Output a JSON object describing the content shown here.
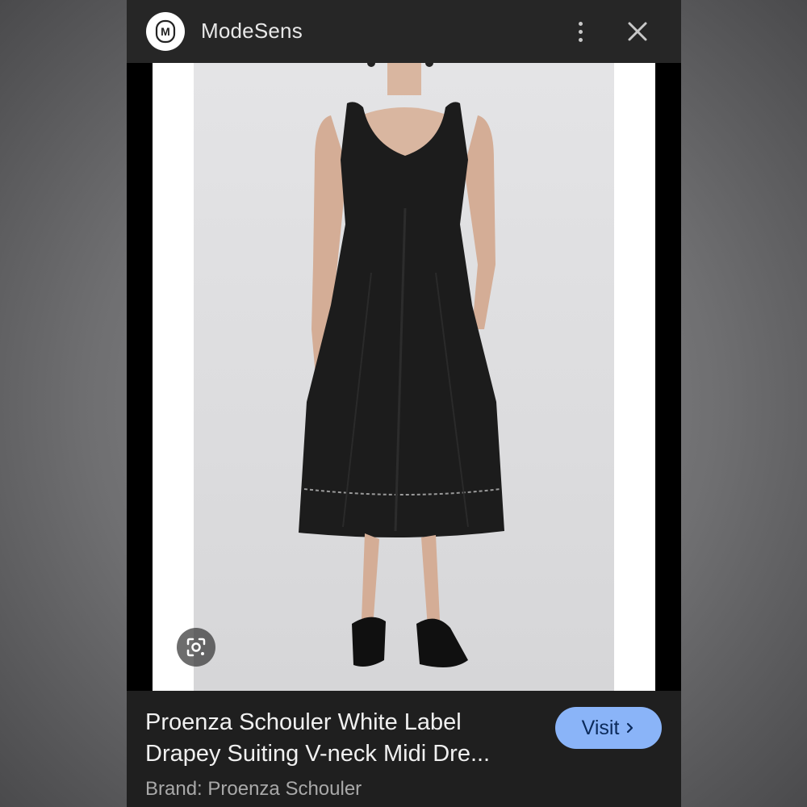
{
  "header": {
    "site_name": "ModeSens",
    "logo_letter": "M",
    "more_icon": "more-vert-icon",
    "close_icon": "close-icon"
  },
  "image": {
    "subject": "model-in-black-midi-dress-photo",
    "lens_icon": "google-lens-icon"
  },
  "result": {
    "title_line1": "Proenza Schouler White Label",
    "title_line2": "Drapey Suiting V-neck Midi Dre...",
    "brand": "Brand: Proenza Schouler",
    "visit_label": "Visit",
    "visit_icon": "chevron-right-icon"
  },
  "colors": {
    "visit_button": "#8ab4f8",
    "panel_background": "#1f1f1f",
    "topbar": "#262626"
  }
}
